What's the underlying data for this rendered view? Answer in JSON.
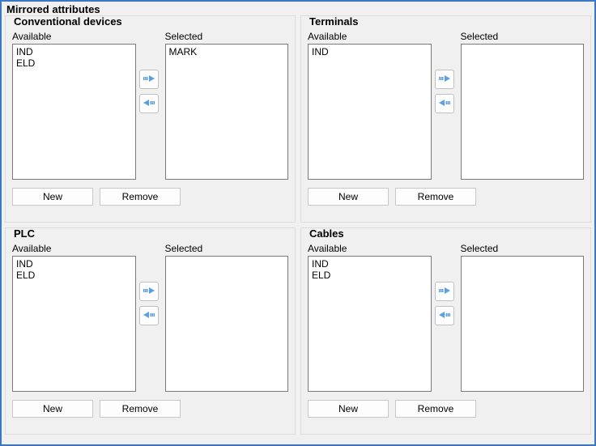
{
  "title": "Mirrored attributes",
  "labels": {
    "available": "Available",
    "selected": "Selected",
    "new": "New",
    "remove": "Remove"
  },
  "groups": {
    "conventional": {
      "title": "Conventional devices",
      "available": [
        "IND",
        "ELD"
      ],
      "selected": [
        "MARK"
      ]
    },
    "terminals": {
      "title": "Terminals",
      "available": [
        "IND"
      ],
      "selected": []
    },
    "plc": {
      "title": "PLC",
      "available": [
        "IND",
        "ELD"
      ],
      "selected": []
    },
    "cables": {
      "title": "Cables",
      "available": [
        "IND",
        "ELD"
      ],
      "selected": []
    }
  },
  "colors": {
    "border": "#3a77c8",
    "arrowIcon": "#5aa0e6"
  }
}
